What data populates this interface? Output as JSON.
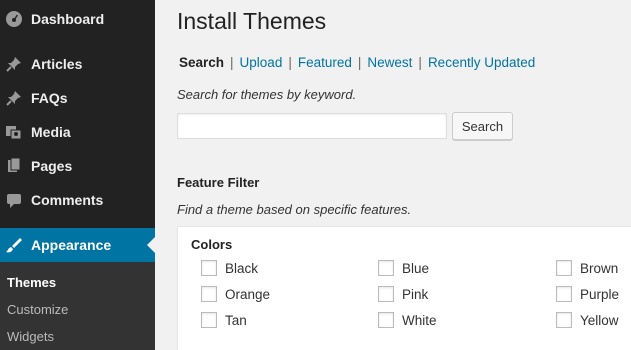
{
  "sidebar": {
    "items": [
      {
        "label": "Dashboard",
        "icon": "dashboard-icon"
      },
      {
        "label": "Articles",
        "icon": "pin-icon"
      },
      {
        "label": "FAQs",
        "icon": "pin-icon"
      },
      {
        "label": "Media",
        "icon": "media-icon"
      },
      {
        "label": "Pages",
        "icon": "pages-icon"
      },
      {
        "label": "Comments",
        "icon": "comment-icon"
      },
      {
        "label": "Appearance",
        "icon": "brush-icon"
      }
    ],
    "submenu": [
      "Themes",
      "Customize",
      "Widgets"
    ]
  },
  "main": {
    "title": "Install Themes",
    "subnav": [
      "Search",
      "Upload",
      "Featured",
      "Newest",
      "Recently Updated"
    ],
    "search_hint": "Search for themes by keyword.",
    "search_value": "",
    "search_button": "Search",
    "filter_title": "Feature Filter",
    "filter_hint": "Find a theme based on specific features.",
    "colors_title": "Colors",
    "colors": [
      [
        "Black",
        "Orange",
        "Tan"
      ],
      [
        "Blue",
        "Pink",
        "White"
      ],
      [
        "Brown",
        "Purple",
        "Yellow"
      ]
    ]
  },
  "colors": {
    "sidebar_bg": "#222222",
    "active_bg": "#0074a2",
    "link": "#0074a2"
  }
}
